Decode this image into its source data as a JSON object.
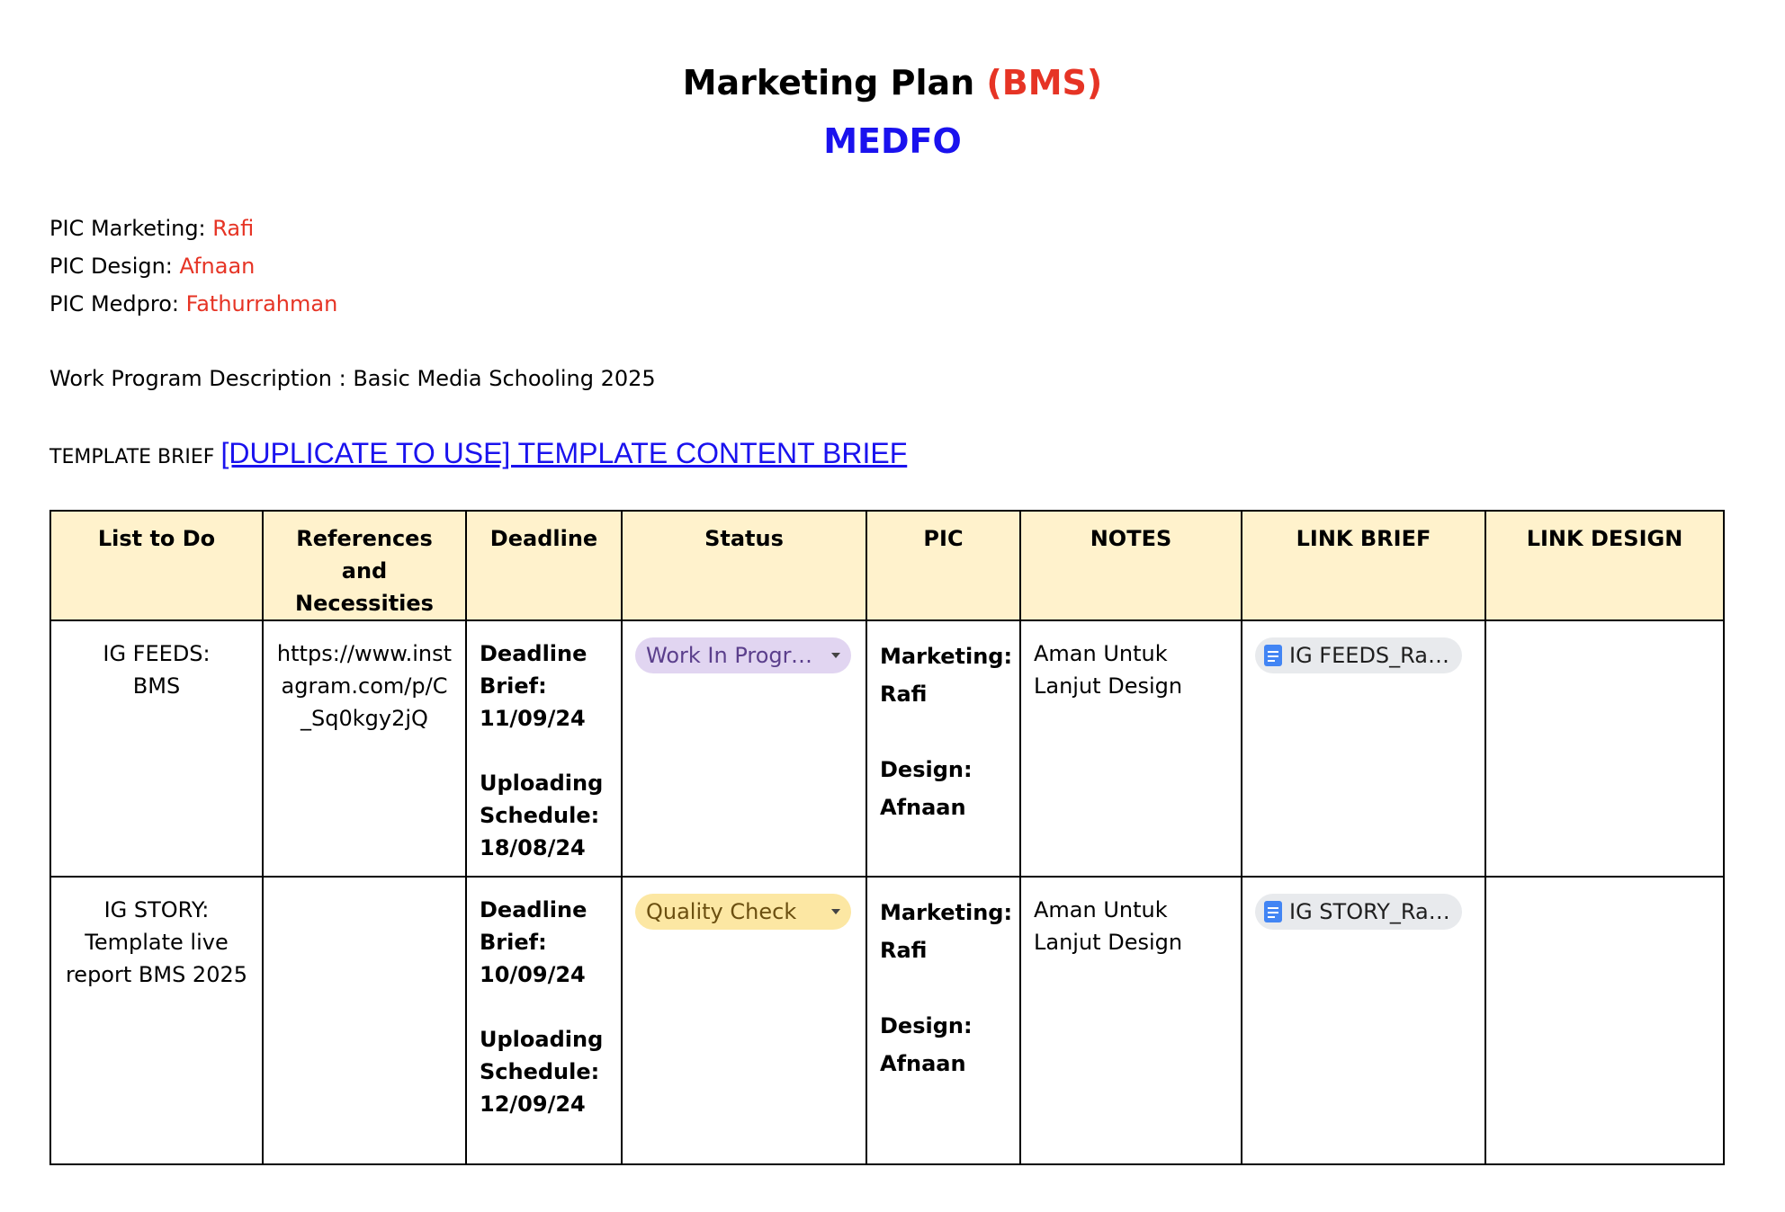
{
  "header": {
    "title": "Marketing Plan ",
    "title_accent": "(BMS)",
    "subtitle": "MEDFO"
  },
  "pic_info": [
    {
      "label": "PIC Marketing: ",
      "value": "Rafi"
    },
    {
      "label": "PIC Design: ",
      "value": "Afnaan"
    },
    {
      "label": "PIC Medpro: ",
      "value": "Fathurrahman"
    }
  ],
  "description": "Work Program Description : Basic Media Schooling 2025",
  "template": {
    "label": "TEMPLATE BRIEF ",
    "link_text": "[DUPLICATE TO USE] TEMPLATE CONTENT BRIEF"
  },
  "table": {
    "headers": [
      "List to Do",
      "References and Necessities",
      "Deadline",
      "Status",
      "PIC",
      "NOTES",
      "LINK BRIEF",
      "LINK DESIGN"
    ],
    "rows": [
      {
        "list_to_do": [
          "IG FEEDS:",
          "BMS"
        ],
        "references": "https://www.instagram.com/p/C_Sq0kgy2jQ",
        "deadline_brief": [
          "Deadline",
          "Brief:",
          "11/09/24"
        ],
        "uploading_schedule": [
          "Uploading",
          "Schedule:",
          "18/08/24"
        ],
        "status": "Work In Progress",
        "pic": {
          "marketing_label": "Marketing:",
          "marketing": "Rafi",
          "design_label": "Design:",
          "design": "Afnaan"
        },
        "notes": "Aman Untuk Lanjut Design",
        "link_brief": "IG FEEDS_Rafi_BMS",
        "link_design": ""
      },
      {
        "list_to_do": [
          "IG STORY:",
          "Template live report BMS 2025"
        ],
        "references": "",
        "deadline_brief": [
          "Deadline",
          "Brief:",
          "10/09/24"
        ],
        "uploading_schedule": [
          "Uploading",
          "Schedule:",
          "12/09/24"
        ],
        "status": "Quality Check",
        "pic": {
          "marketing_label": "Marketing:",
          "marketing": "Rafi",
          "design_label": "Design:",
          "design": "Afnaan"
        },
        "notes": "Aman Untuk Lanjut Design",
        "link_brief": "IG STORY_Rafi_BMS",
        "link_design": ""
      }
    ]
  },
  "colors": {
    "accent_red": "#e63425",
    "accent_blue": "#1a12ee",
    "header_fill": "#fff2cc",
    "status_wip": "#e1d5f1",
    "status_qc": "#fce7a3",
    "doc_icon": "#4285f4"
  },
  "icons": [
    "google-docs-icon",
    "dropdown-caret-icon"
  ]
}
